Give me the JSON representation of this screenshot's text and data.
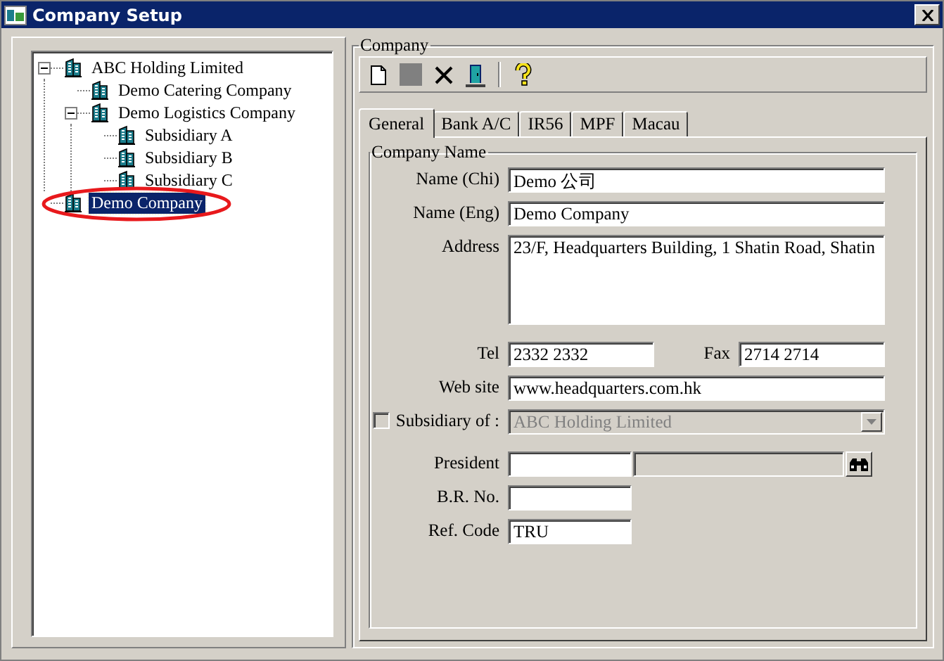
{
  "window": {
    "title": "Company Setup"
  },
  "tree": [
    {
      "label": "ABC Holding Limited",
      "selected": false,
      "circled": false,
      "expanded": true,
      "children": [
        {
          "label": "Demo Catering Company",
          "selected": false,
          "circled": false
        },
        {
          "label": "Demo Logistics Company",
          "selected": false,
          "circled": false,
          "expanded": true,
          "children": [
            {
              "label": "Subsidiary A",
              "selected": false,
              "circled": false
            },
            {
              "label": "Subsidiary B",
              "selected": false,
              "circled": false
            },
            {
              "label": "Subsidiary C",
              "selected": false,
              "circled": false
            }
          ]
        }
      ]
    },
    {
      "label": "Demo Company",
      "selected": true,
      "circled": true
    }
  ],
  "company_group": {
    "title": "Company"
  },
  "toolbar": [
    {
      "kind": "new"
    },
    {
      "kind": "blank"
    },
    {
      "kind": "delete"
    },
    {
      "kind": "exit"
    },
    {
      "kind": "separator"
    },
    {
      "kind": "help"
    }
  ],
  "tabs": [
    {
      "label": "General",
      "selected": true
    },
    {
      "label": "Bank A/C",
      "selected": false
    },
    {
      "label": "IR56",
      "selected": false
    },
    {
      "label": "MPF",
      "selected": false
    },
    {
      "label": "Macau",
      "selected": false
    }
  ],
  "form": {
    "title": "Company Name",
    "name_chi": {
      "label": "Name (Chi)",
      "value": "Demo 公司"
    },
    "name_eng": {
      "label": "Name (Eng)",
      "value": "Demo Company"
    },
    "address": {
      "label": "Address",
      "value": "23/F, Headquarters Building, 1 Shatin Road, Shatin"
    },
    "tel": {
      "label": "Tel",
      "value": "2332 2332"
    },
    "fax": {
      "label": "Fax",
      "value": "2714 2714"
    },
    "website": {
      "label": "Web site",
      "value": "www.headquarters.com.hk"
    },
    "subsidiary_of": {
      "label": "Subsidiary of :",
      "checked": false,
      "disabled": true,
      "value": "ABC Holding Limited"
    },
    "president": {
      "label": "President"
    },
    "br_no": {
      "label": "B.R. No."
    },
    "ref_code": {
      "label": "Ref. Code",
      "value": "TRU"
    }
  }
}
